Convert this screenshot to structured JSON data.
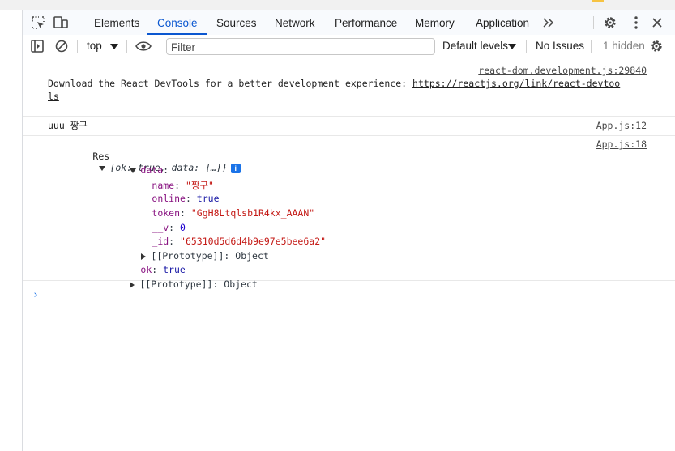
{
  "tabs": [
    {
      "label": "Elements",
      "active": false
    },
    {
      "label": "Console",
      "active": true
    },
    {
      "label": "Sources",
      "active": false
    },
    {
      "label": "Network",
      "active": false
    },
    {
      "label": "Performance",
      "active": false
    },
    {
      "label": "Memory",
      "active": false
    },
    {
      "label": "Application",
      "active": false
    }
  ],
  "toolbar": {
    "context": "top",
    "filter_placeholder": "Filter",
    "levels": "Default levels",
    "issues": "No Issues",
    "hidden": "1 hidden"
  },
  "messages": {
    "devtools": {
      "source": "react-dom.development.js:29840",
      "text": "Download the React DevTools for a better development experience: ",
      "link_line1": "https://reactjs.org/link/react-devtoo",
      "link_line2": "ls"
    },
    "uuu": {
      "text": "uuu 짱구",
      "source": "App.js:12"
    },
    "res": {
      "label": "Res",
      "summary": "{ok: true, data: {…}}",
      "info_icon": "i",
      "source": "App.js:18",
      "data_key": "data",
      "fields": [
        {
          "key": "name",
          "value": "\"짱구\"",
          "kind": "str"
        },
        {
          "key": "online",
          "value": "true",
          "kind": "kw"
        },
        {
          "key": "token",
          "value": "\"GgH8Ltqlsb1R4kx_AAAN\"",
          "kind": "str"
        },
        {
          "key": "__v",
          "value": "0",
          "kind": "num"
        },
        {
          "key": "_id",
          "value": "\"65310d5d6d4b9e97e5bee6a2\"",
          "kind": "str"
        }
      ],
      "data_proto": "[[Prototype]]",
      "data_proto_value": "Object",
      "ok_key": "ok",
      "ok_value": "true",
      "proto": "[[Prototype]]",
      "proto_value": "Object"
    }
  },
  "prompt_symbol": "›"
}
